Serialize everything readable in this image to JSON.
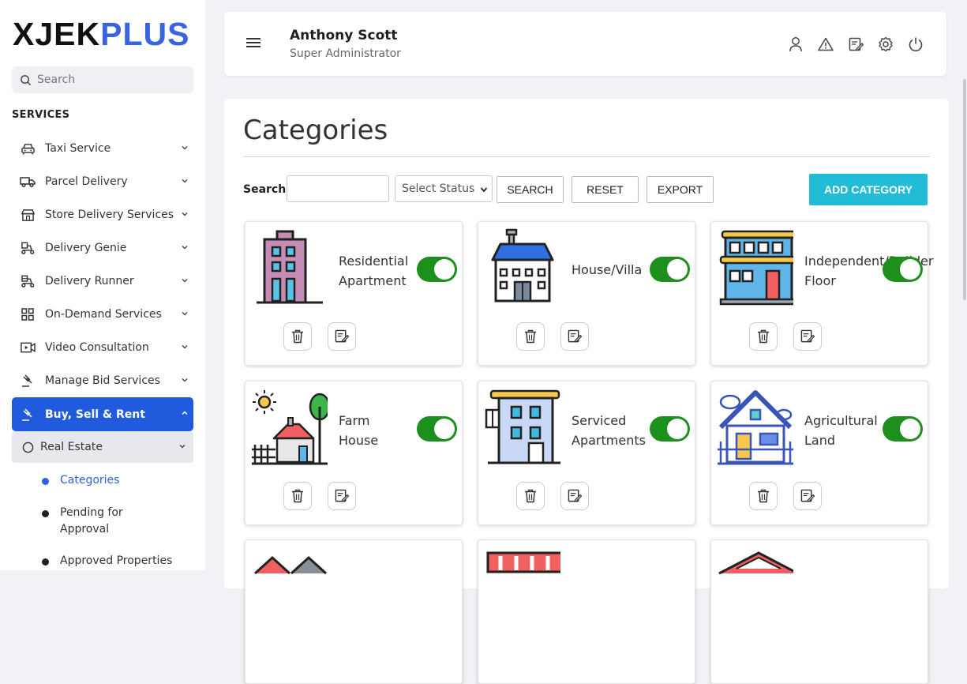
{
  "brand": {
    "part1": "XJEK",
    "part2": "PLUS"
  },
  "sidebar": {
    "search_placeholder": "Search",
    "section_title": "SERVICES",
    "items": [
      {
        "label": "Taxi Service",
        "icon": "taxi-icon"
      },
      {
        "label": "Parcel Delivery",
        "icon": "truck-icon"
      },
      {
        "label": "Store Delivery Services",
        "icon": "store-icon"
      },
      {
        "label": "Delivery Genie",
        "icon": "scooter-icon"
      },
      {
        "label": "Delivery Runner",
        "icon": "runner-scooter-icon"
      },
      {
        "label": "On-Demand Services",
        "icon": "grid-icon"
      },
      {
        "label": "Video Consultation",
        "icon": "video-icon"
      },
      {
        "label": "Manage Bid Services",
        "icon": "gavel-icon"
      },
      {
        "label": "Buy, Sell & Rent",
        "icon": "gavel-icon"
      }
    ],
    "submenu": {
      "label": "Real Estate"
    },
    "leaves": [
      "Categories",
      "Pending for Approval",
      "Approved Properties"
    ]
  },
  "topbar": {
    "user_name": "Anthony Scott",
    "user_role": "Super Administrator"
  },
  "page": {
    "title": "Categories",
    "filter": {
      "search_label": "Search:",
      "search_value": "",
      "status_selected": "Select Status",
      "search_button": "SEARCH",
      "reset_button": "RESET",
      "export_button": "EXPORT",
      "add_button": "ADD CATEGORY"
    }
  },
  "categories": [
    {
      "name": "Residential Apartment",
      "enabled": true,
      "icon": "apartment-building-icon"
    },
    {
      "name": "House/Villa",
      "enabled": true,
      "icon": "villa-icon"
    },
    {
      "name": "Independent/Builder Floor",
      "enabled": true,
      "icon": "builder-floor-icon"
    },
    {
      "name": "Farm House",
      "enabled": true,
      "icon": "farm-house-icon"
    },
    {
      "name": "Serviced Apartments",
      "enabled": true,
      "icon": "serviced-apartment-icon"
    },
    {
      "name": "Agricultural Land",
      "enabled": true,
      "icon": "agricultural-house-icon"
    }
  ],
  "colors": {
    "accent": "#1f5bdc",
    "add_button": "#22bcd7",
    "toggle_on": "#1c8f1c",
    "brand_plus": "#3a63e0"
  }
}
